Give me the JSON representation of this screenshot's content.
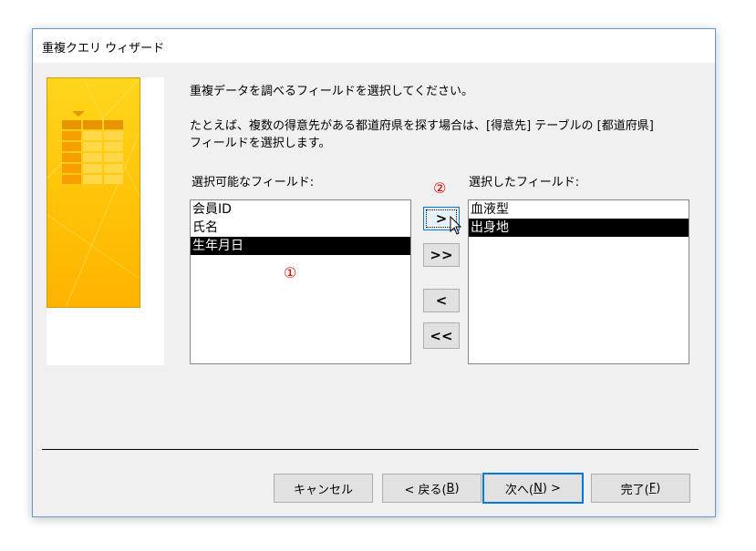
{
  "window": {
    "title": "重複クエリ ウィザード"
  },
  "instructions": {
    "line1": "重複データを調べるフィールドを選択してください。",
    "line2": "たとえば、複数の得意先がある都道府県を探す場合は、[得意先] テーブルの [都道府県]",
    "line3": "フィールドを選択します。"
  },
  "available": {
    "label": "選択可能なフィールド:",
    "items": [
      "会員ID",
      "氏名",
      "生年月日"
    ],
    "selected_index": 2
  },
  "selected": {
    "label": "選択したフィールド:",
    "items": [
      "血液型",
      "出身地"
    ],
    "selected_index": 1
  },
  "move_buttons": {
    "add": ">",
    "add_all": ">>",
    "remove": "<",
    "remove_all": "<<"
  },
  "annotations": {
    "mark1": "①",
    "mark2": "②"
  },
  "footer": {
    "cancel": "キャンセル",
    "back_prefix": "< 戻る(",
    "back_key": "B",
    "back_suffix": ")",
    "next_prefix": "次へ(",
    "next_key": "N",
    "next_suffix": ") >",
    "finish_prefix": "完了(",
    "finish_key": "F",
    "finish_suffix": ")"
  },
  "colors": {
    "accent": "#0078d7",
    "art_yellow": "#ffc107",
    "annotation_red": "#e60000",
    "selection": "#000000"
  }
}
